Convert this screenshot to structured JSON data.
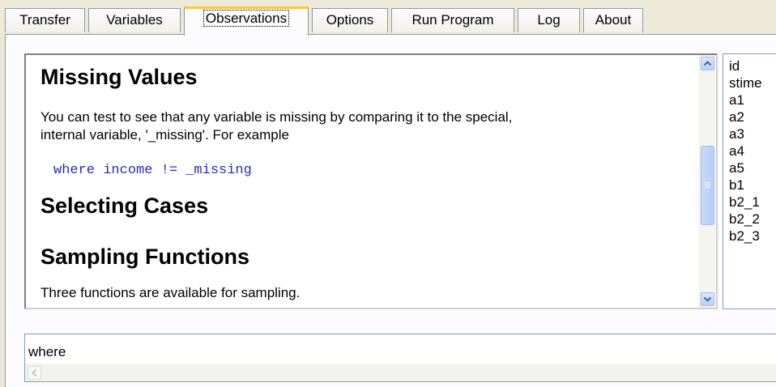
{
  "tabs": [
    {
      "label": "Transfer"
    },
    {
      "label": "Variables"
    },
    {
      "label": "Observations"
    },
    {
      "label": "Options"
    },
    {
      "label": "Run Program"
    },
    {
      "label": "Log"
    },
    {
      "label": "About"
    }
  ],
  "active_tab": "Observations",
  "help": {
    "heading_missing": "Missing Values",
    "missing_text_1": "You can test to see that any variable is missing by comparing it to the special,",
    "missing_text_2": "internal variable, '_missing'. For example",
    "code_example": "where income != _missing",
    "heading_selecting": "Selecting Cases",
    "heading_sampling": "Sampling Functions",
    "sampling_text": "Three functions are available for sampling."
  },
  "variables": [
    "id",
    "stime",
    "a1",
    "a2",
    "a3",
    "a4",
    "a5",
    "b1",
    "b2_1",
    "b2_2",
    "b2_3"
  ],
  "command": {
    "value": "where"
  },
  "icons": {
    "scroll_up": "scroll-up-icon",
    "scroll_down": "scroll-down-icon",
    "scroll_left": "scroll-left-icon"
  },
  "colors": {
    "code_text": "#2b2bb8",
    "active_tab_accent": "#ffc83c",
    "window_bg": "#ece9d8"
  }
}
